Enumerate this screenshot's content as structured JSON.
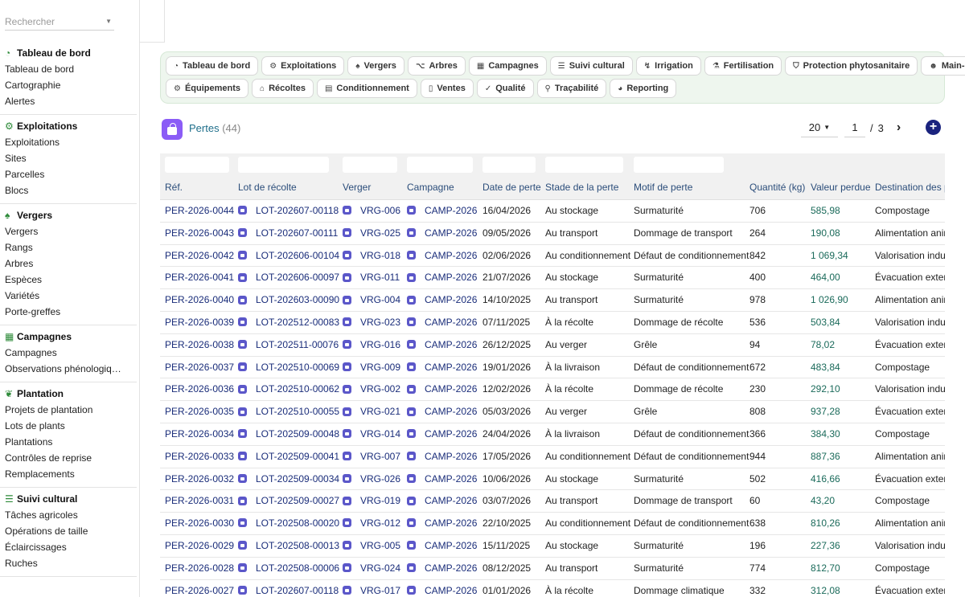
{
  "search": {
    "placeholder": "Rechercher"
  },
  "sidebar": {
    "groups": [
      {
        "title": "Tableau de bord",
        "icon": "dashboard-icon",
        "items": [
          "Tableau de bord",
          "Cartographie",
          "Alertes"
        ]
      },
      {
        "title": "Exploitations",
        "icon": "tractor-icon",
        "items": [
          "Exploitations",
          "Sites",
          "Parcelles",
          "Blocs"
        ]
      },
      {
        "title": "Vergers",
        "icon": "tree-icon",
        "items": [
          "Vergers",
          "Rangs",
          "Arbres",
          "Espèces",
          "Variétés",
          "Porte-greffes"
        ]
      },
      {
        "title": "Campagnes",
        "icon": "calendar-icon",
        "items": [
          "Campagnes",
          "Observations phénologiq…"
        ]
      },
      {
        "title": "Plantation",
        "icon": "seedling-icon",
        "items": [
          "Projets de plantation",
          "Lots de plants",
          "Plantations",
          "Contrôles de reprise",
          "Remplacements"
        ]
      },
      {
        "title": "Suivi cultural",
        "icon": "list-icon",
        "items": [
          "Tâches agricoles",
          "Opérations de taille",
          "Éclaircissages",
          "Ruches"
        ]
      }
    ]
  },
  "modules": {
    "row1": [
      {
        "label": "Tableau de bord",
        "icon": "dashboard-icon"
      },
      {
        "label": "Exploitations",
        "icon": "tractor-icon"
      },
      {
        "label": "Vergers",
        "icon": "tree-icon"
      },
      {
        "label": "Arbres",
        "icon": "branch-icon"
      },
      {
        "label": "Campagnes",
        "icon": "calendar-icon"
      },
      {
        "label": "Suivi cultural",
        "icon": "list-icon"
      },
      {
        "label": "Irrigation",
        "icon": "water-icon"
      },
      {
        "label": "Fertilisation",
        "icon": "flask-icon"
      },
      {
        "label": "Protection phytosanitaire",
        "icon": "shield-icon"
      },
      {
        "label": "Main-d'oeuvre",
        "icon": "users-icon"
      }
    ],
    "row2": [
      {
        "label": "Équipements",
        "icon": "equipment-icon"
      },
      {
        "label": "Récoltes",
        "icon": "basket-icon"
      },
      {
        "label": "Conditionnement",
        "icon": "box-icon"
      },
      {
        "label": "Ventes",
        "icon": "receipt-icon"
      },
      {
        "label": "Qualité",
        "icon": "check-icon"
      },
      {
        "label": "Traçabilité",
        "icon": "trace-icon"
      },
      {
        "label": "Reporting",
        "icon": "chart-icon"
      }
    ]
  },
  "header": {
    "title": "Pertes",
    "count": "(44)"
  },
  "pager": {
    "per_page": "20",
    "page": "1",
    "separator": "/",
    "total_pages": "3"
  },
  "columns": [
    "Réf.",
    "Lot de récolte",
    "Verger",
    "Campagne",
    "Date de perte",
    "Stade de la perte",
    "Motif de perte",
    "Quantité (kg)",
    "Valeur perdue",
    "Destination des p"
  ],
  "rows": [
    [
      "PER-2026-0044",
      "LOT-202607-00118",
      "VRG-006",
      "CAMP-2026",
      "16/04/2026",
      "Au stockage",
      "Surmaturité",
      "706",
      "585,98",
      "Compostage"
    ],
    [
      "PER-2026-0043",
      "LOT-202607-00111",
      "VRG-025",
      "CAMP-2026",
      "09/05/2026",
      "Au transport",
      "Dommage de transport",
      "264",
      "190,08",
      "Alimentation anim"
    ],
    [
      "PER-2026-0042",
      "LOT-202606-00104",
      "VRG-018",
      "CAMP-2026",
      "02/06/2026",
      "Au conditionnement",
      "Défaut de conditionnement",
      "842",
      "1 069,34",
      "Valorisation indus"
    ],
    [
      "PER-2026-0041",
      "LOT-202606-00097",
      "VRG-011",
      "CAMP-2026",
      "21/07/2026",
      "Au stockage",
      "Surmaturité",
      "400",
      "464,00",
      "Évacuation exterr"
    ],
    [
      "PER-2026-0040",
      "LOT-202603-00090",
      "VRG-004",
      "CAMP-2026",
      "14/10/2025",
      "Au transport",
      "Surmaturité",
      "978",
      "1 026,90",
      "Alimentation anim"
    ],
    [
      "PER-2026-0039",
      "LOT-202512-00083",
      "VRG-023",
      "CAMP-2026",
      "07/11/2025",
      "À la récolte",
      "Dommage de récolte",
      "536",
      "503,84",
      "Valorisation indus"
    ],
    [
      "PER-2026-0038",
      "LOT-202511-00076",
      "VRG-016",
      "CAMP-2026",
      "26/12/2025",
      "Au verger",
      "Grêle",
      "94",
      "78,02",
      "Évacuation exterr"
    ],
    [
      "PER-2026-0037",
      "LOT-202510-00069",
      "VRG-009",
      "CAMP-2026",
      "19/01/2026",
      "À la livraison",
      "Défaut de conditionnement",
      "672",
      "483,84",
      "Compostage"
    ],
    [
      "PER-2026-0036",
      "LOT-202510-00062",
      "VRG-002",
      "CAMP-2026",
      "12/02/2026",
      "À la récolte",
      "Dommage de récolte",
      "230",
      "292,10",
      "Valorisation indus"
    ],
    [
      "PER-2026-0035",
      "LOT-202510-00055",
      "VRG-021",
      "CAMP-2026",
      "05/03/2026",
      "Au verger",
      "Grêle",
      "808",
      "937,28",
      "Évacuation exterr"
    ],
    [
      "PER-2026-0034",
      "LOT-202509-00048",
      "VRG-014",
      "CAMP-2026",
      "24/04/2026",
      "À la livraison",
      "Défaut de conditionnement",
      "366",
      "384,30",
      "Compostage"
    ],
    [
      "PER-2026-0033",
      "LOT-202509-00041",
      "VRG-007",
      "CAMP-2026",
      "17/05/2026",
      "Au conditionnement",
      "Défaut de conditionnement",
      "944",
      "887,36",
      "Alimentation anim"
    ],
    [
      "PER-2026-0032",
      "LOT-202509-00034",
      "VRG-026",
      "CAMP-2026",
      "10/06/2026",
      "Au stockage",
      "Surmaturité",
      "502",
      "416,66",
      "Évacuation exterr"
    ],
    [
      "PER-2026-0031",
      "LOT-202509-00027",
      "VRG-019",
      "CAMP-2026",
      "03/07/2026",
      "Au transport",
      "Dommage de transport",
      "60",
      "43,20",
      "Compostage"
    ],
    [
      "PER-2026-0030",
      "LOT-202508-00020",
      "VRG-012",
      "CAMP-2026",
      "22/10/2025",
      "Au conditionnement",
      "Défaut de conditionnement",
      "638",
      "810,26",
      "Alimentation anim"
    ],
    [
      "PER-2026-0029",
      "LOT-202508-00013",
      "VRG-005",
      "CAMP-2026",
      "15/11/2025",
      "Au stockage",
      "Surmaturité",
      "196",
      "227,36",
      "Valorisation indus"
    ],
    [
      "PER-2026-0028",
      "LOT-202508-00006",
      "VRG-024",
      "CAMP-2026",
      "08/12/2025",
      "Au transport",
      "Surmaturité",
      "774",
      "812,70",
      "Compostage"
    ],
    [
      "PER-2026-0027",
      "LOT-202607-00118",
      "VRG-017",
      "CAMP-2026",
      "01/01/2026",
      "À la récolte",
      "Dommage climatique",
      "332",
      "312,08",
      "Évacuation exterr"
    ]
  ]
}
